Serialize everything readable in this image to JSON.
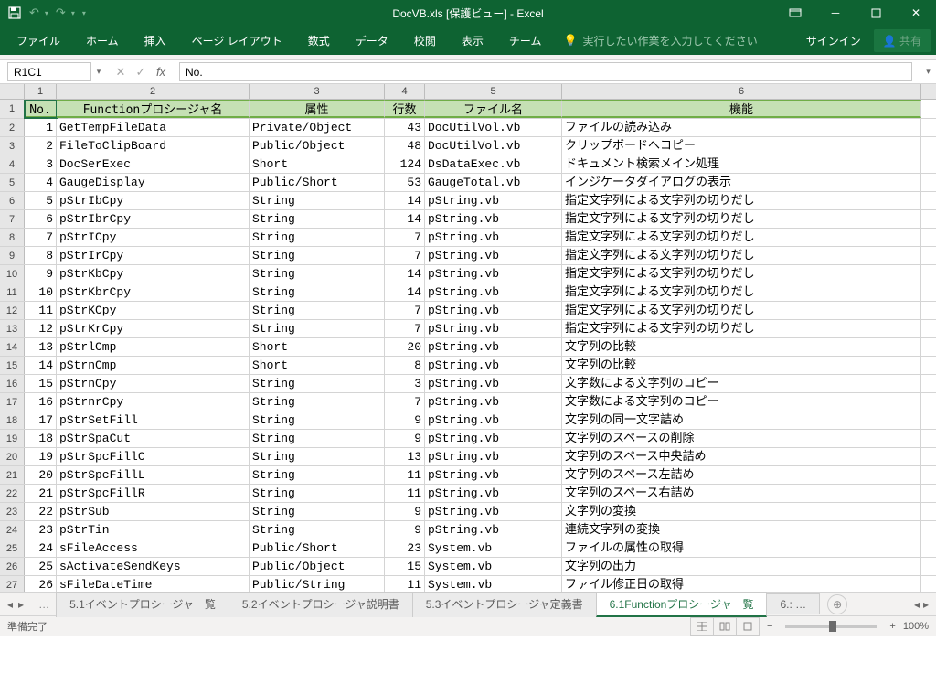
{
  "title": "DocVB.xls [保護ビュー] - Excel",
  "qa": {
    "undo": "↶",
    "redo": "↷"
  },
  "ribbon": {
    "tabs": [
      "ファイル",
      "ホーム",
      "挿入",
      "ページ レイアウト",
      "数式",
      "データ",
      "校閲",
      "表示",
      "チーム"
    ],
    "tellme": "実行したい作業を入力してください",
    "signin": "サインイン",
    "share": "共有"
  },
  "namebox": "R1C1",
  "formula": "No.",
  "col_nums": [
    "1",
    "2",
    "3",
    "4",
    "5",
    "6"
  ],
  "headers": [
    "No.",
    "Functionプロシージャ名",
    "属性",
    "行数",
    "ファイル名",
    "機能"
  ],
  "rows": [
    {
      "n": "1",
      "f": "GetTempFileData",
      "a": "Private/Object",
      "l": "43",
      "fn": "DocUtilVol.vb",
      "d": "ファイルの読み込み"
    },
    {
      "n": "2",
      "f": "FileToClipBoard",
      "a": "Public/Object",
      "l": "48",
      "fn": "DocUtilVol.vb",
      "d": "クリップボードへコピー"
    },
    {
      "n": "3",
      "f": "DocSerExec",
      "a": "Short",
      "l": "124",
      "fn": "DsDataExec.vb",
      "d": "ドキュメント検索メイン処理"
    },
    {
      "n": "4",
      "f": "GaugeDisplay",
      "a": "Public/Short",
      "l": "53",
      "fn": "GaugeTotal.vb",
      "d": "インジケータダイアログの表示"
    },
    {
      "n": "5",
      "f": "pStrIbCpy",
      "a": "String",
      "l": "14",
      "fn": "pString.vb",
      "d": "指定文字列による文字列の切りだし"
    },
    {
      "n": "6",
      "f": "pStrIbrCpy",
      "a": "String",
      "l": "14",
      "fn": "pString.vb",
      "d": "指定文字列による文字列の切りだし"
    },
    {
      "n": "7",
      "f": "pStrICpy",
      "a": "String",
      "l": "7",
      "fn": "pString.vb",
      "d": "指定文字列による文字列の切りだし"
    },
    {
      "n": "8",
      "f": "pStrIrCpy",
      "a": "String",
      "l": "7",
      "fn": "pString.vb",
      "d": "指定文字列による文字列の切りだし"
    },
    {
      "n": "9",
      "f": "pStrKbCpy",
      "a": "String",
      "l": "14",
      "fn": "pString.vb",
      "d": "指定文字列による文字列の切りだし"
    },
    {
      "n": "10",
      "f": "pStrKbrCpy",
      "a": "String",
      "l": "14",
      "fn": "pString.vb",
      "d": "指定文字列による文字列の切りだし"
    },
    {
      "n": "11",
      "f": "pStrKCpy",
      "a": "String",
      "l": "7",
      "fn": "pString.vb",
      "d": "指定文字列による文字列の切りだし"
    },
    {
      "n": "12",
      "f": "pStrKrCpy",
      "a": "String",
      "l": "7",
      "fn": "pString.vb",
      "d": "指定文字列による文字列の切りだし"
    },
    {
      "n": "13",
      "f": "pStrlCmp",
      "a": "Short",
      "l": "20",
      "fn": "pString.vb",
      "d": "文字列の比較"
    },
    {
      "n": "14",
      "f": "pStrnCmp",
      "a": "Short",
      "l": "8",
      "fn": "pString.vb",
      "d": "文字列の比較"
    },
    {
      "n": "15",
      "f": "pStrnCpy",
      "a": "String",
      "l": "3",
      "fn": "pString.vb",
      "d": "文字数による文字列のコピー"
    },
    {
      "n": "16",
      "f": "pStrnrCpy",
      "a": "String",
      "l": "7",
      "fn": "pString.vb",
      "d": "文字数による文字列のコピー"
    },
    {
      "n": "17",
      "f": "pStrSetFill",
      "a": "String",
      "l": "9",
      "fn": "pString.vb",
      "d": "文字列の同一文字詰め"
    },
    {
      "n": "18",
      "f": "pStrSpaCut",
      "a": "String",
      "l": "9",
      "fn": "pString.vb",
      "d": "文字列のスペースの削除"
    },
    {
      "n": "19",
      "f": "pStrSpcFillC",
      "a": "String",
      "l": "13",
      "fn": "pString.vb",
      "d": "文字列のスペース中央詰め"
    },
    {
      "n": "20",
      "f": "pStrSpcFillL",
      "a": "String",
      "l": "11",
      "fn": "pString.vb",
      "d": "文字列のスペース左詰め"
    },
    {
      "n": "21",
      "f": "pStrSpcFillR",
      "a": "String",
      "l": "11",
      "fn": "pString.vb",
      "d": "文字列のスペース右詰め"
    },
    {
      "n": "22",
      "f": "pStrSub",
      "a": "String",
      "l": "9",
      "fn": "pString.vb",
      "d": "文字列の変換"
    },
    {
      "n": "23",
      "f": "pStrTin",
      "a": "String",
      "l": "9",
      "fn": "pString.vb",
      "d": "連続文字列の変換"
    },
    {
      "n": "24",
      "f": "sFileAccess",
      "a": "Public/Short",
      "l": "23",
      "fn": "System.vb",
      "d": "ファイルの属性の取得"
    },
    {
      "n": "25",
      "f": "sActivateSendKeys",
      "a": "Public/Object",
      "l": "15",
      "fn": "System.vb",
      "d": "文字列の出力"
    },
    {
      "n": "26",
      "f": "sFileDateTime",
      "a": "Public/String",
      "l": "11",
      "fn": "System.vb",
      "d": "ファイル修正日の取得"
    }
  ],
  "sheets": {
    "dots": "…",
    "tabs": [
      "5.1イベントプロシージャ一覧",
      "5.2イベントプロシージャ説明書",
      "5.3イベントプロシージャ定義書",
      "6.1Functionプロシージャ一覧"
    ],
    "more": "6.:",
    "active": 3
  },
  "status": {
    "ready": "準備完了",
    "zoom": "100%"
  }
}
